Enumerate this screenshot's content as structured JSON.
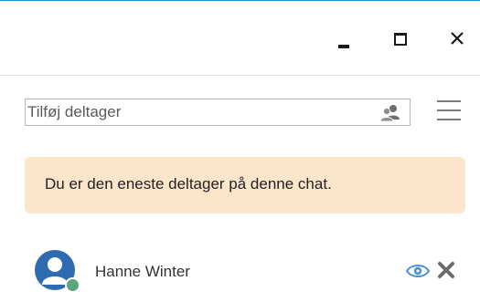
{
  "window": {
    "accent_color": "#1e90d6",
    "buttons": {
      "minimize_icon": "minimize-icon",
      "maximize_icon": "maximize-icon",
      "close_icon": "close-icon"
    }
  },
  "toolbar": {
    "search_placeholder": "Tilføj deltager",
    "add_participants_icon": "people-icon",
    "menu_icon": "hamburger-menu-icon"
  },
  "notice": {
    "text": "Du er den eneste deltager på denne chat.",
    "background": "#fbe6cc"
  },
  "participants": [
    {
      "name": "Hanne Winter",
      "avatar_color": "#2f6bb0",
      "presence_color": "#5aa57a",
      "view_icon": "eye-icon",
      "remove_icon": "remove-icon"
    }
  ]
}
